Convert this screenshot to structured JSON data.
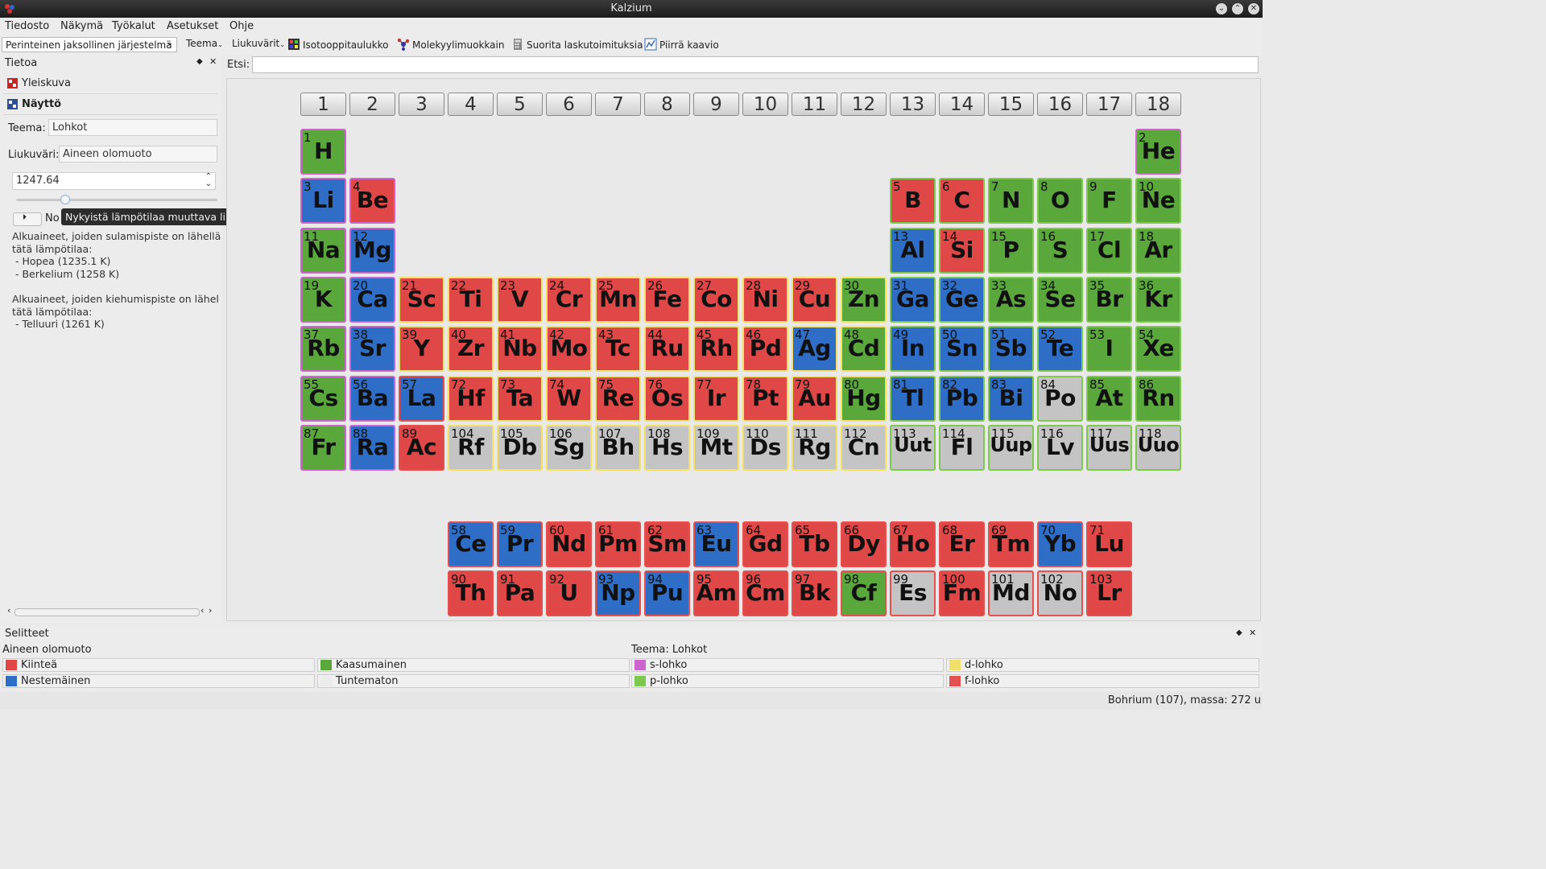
{
  "window": {
    "title": "Kalzium"
  },
  "menubar": {
    "items": [
      "Tiedosto",
      "Näkymä",
      "Työkalut",
      "Asetukset",
      "Ohje"
    ]
  },
  "toolbar": {
    "scheme_select": "Perinteinen jaksollinen järjestelmä",
    "theme_button": "Teema",
    "gradient_button": "Liukuvärit",
    "isotope_button": "Isotooppitaulukko",
    "molecule_button": "Molekyylimuokkain",
    "calculate_button": "Suorita laskutoimituksia",
    "plot_button": "Piirrä kaavio"
  },
  "sidepanel": {
    "title": "Tietoa",
    "tab_overview": "Yleiskuva",
    "tab_display": "Näyttö",
    "theme_label": "Teema:",
    "theme_value": "Lohkot",
    "gradient_label": "Liukuväri:",
    "gradient_value": "Aineen olomuoto",
    "temperature_value": "1247.64",
    "slider_fraction": 0.23,
    "play_label": "No",
    "tooltip": "Nykyistä lämpötilaa muuttava liukusäädin",
    "melting_text": "Alkuaineet, joiden sulamispiste on lähellä\ntätä lämpötilaa:\n - Hopea (1235.1 K)\n - Berkelium (1258 K)",
    "boiling_text": "Alkuaineet, joiden kiehumispiste on lähel\ntätä lämpötilaa:\n - Telluuri (1261 K)"
  },
  "search": {
    "label": "Etsi:",
    "value": ""
  },
  "groups": [
    "1",
    "2",
    "3",
    "4",
    "5",
    "6",
    "7",
    "8",
    "9",
    "10",
    "11",
    "12",
    "13",
    "14",
    "15",
    "16",
    "17",
    "18"
  ],
  "state_colors": {
    "solid": "#e04848",
    "liquid": "#2e6ec6",
    "gas": "#5aa83c",
    "unknown": "#c4c4c4"
  },
  "block_colors": {
    "s": "#cc66cc",
    "p": "#7ec850",
    "d": "#f2e06a",
    "f": "#e45050"
  },
  "elements": [
    {
      "n": 1,
      "s": "H",
      "g": 1,
      "p": 1,
      "st": "gas",
      "b": "s"
    },
    {
      "n": 2,
      "s": "He",
      "g": 18,
      "p": 1,
      "st": "gas",
      "b": "s"
    },
    {
      "n": 3,
      "s": "Li",
      "g": 1,
      "p": 2,
      "st": "liquid",
      "b": "s"
    },
    {
      "n": 4,
      "s": "Be",
      "g": 2,
      "p": 2,
      "st": "solid",
      "b": "s"
    },
    {
      "n": 5,
      "s": "B",
      "g": 13,
      "p": 2,
      "st": "solid",
      "b": "p"
    },
    {
      "n": 6,
      "s": "C",
      "g": 14,
      "p": 2,
      "st": "solid",
      "b": "p"
    },
    {
      "n": 7,
      "s": "N",
      "g": 15,
      "p": 2,
      "st": "gas",
      "b": "p"
    },
    {
      "n": 8,
      "s": "O",
      "g": 16,
      "p": 2,
      "st": "gas",
      "b": "p"
    },
    {
      "n": 9,
      "s": "F",
      "g": 17,
      "p": 2,
      "st": "gas",
      "b": "p"
    },
    {
      "n": 10,
      "s": "Ne",
      "g": 18,
      "p": 2,
      "st": "gas",
      "b": "p"
    },
    {
      "n": 11,
      "s": "Na",
      "g": 1,
      "p": 3,
      "st": "gas",
      "b": "s"
    },
    {
      "n": 12,
      "s": "Mg",
      "g": 2,
      "p": 3,
      "st": "liquid",
      "b": "s"
    },
    {
      "n": 13,
      "s": "Al",
      "g": 13,
      "p": 3,
      "st": "liquid",
      "b": "p"
    },
    {
      "n": 14,
      "s": "Si",
      "g": 14,
      "p": 3,
      "st": "solid",
      "b": "p"
    },
    {
      "n": 15,
      "s": "P",
      "g": 15,
      "p": 3,
      "st": "gas",
      "b": "p"
    },
    {
      "n": 16,
      "s": "S",
      "g": 16,
      "p": 3,
      "st": "gas",
      "b": "p"
    },
    {
      "n": 17,
      "s": "Cl",
      "g": 17,
      "p": 3,
      "st": "gas",
      "b": "p"
    },
    {
      "n": 18,
      "s": "Ar",
      "g": 18,
      "p": 3,
      "st": "gas",
      "b": "p"
    },
    {
      "n": 19,
      "s": "K",
      "g": 1,
      "p": 4,
      "st": "gas",
      "b": "s"
    },
    {
      "n": 20,
      "s": "Ca",
      "g": 2,
      "p": 4,
      "st": "liquid",
      "b": "s"
    },
    {
      "n": 21,
      "s": "Sc",
      "g": 3,
      "p": 4,
      "st": "solid",
      "b": "d"
    },
    {
      "n": 22,
      "s": "Ti",
      "g": 4,
      "p": 4,
      "st": "solid",
      "b": "d"
    },
    {
      "n": 23,
      "s": "V",
      "g": 5,
      "p": 4,
      "st": "solid",
      "b": "d"
    },
    {
      "n": 24,
      "s": "Cr",
      "g": 6,
      "p": 4,
      "st": "solid",
      "b": "d"
    },
    {
      "n": 25,
      "s": "Mn",
      "g": 7,
      "p": 4,
      "st": "solid",
      "b": "d"
    },
    {
      "n": 26,
      "s": "Fe",
      "g": 8,
      "p": 4,
      "st": "solid",
      "b": "d"
    },
    {
      "n": 27,
      "s": "Co",
      "g": 9,
      "p": 4,
      "st": "solid",
      "b": "d"
    },
    {
      "n": 28,
      "s": "Ni",
      "g": 10,
      "p": 4,
      "st": "solid",
      "b": "d"
    },
    {
      "n": 29,
      "s": "Cu",
      "g": 11,
      "p": 4,
      "st": "solid",
      "b": "d"
    },
    {
      "n": 30,
      "s": "Zn",
      "g": 12,
      "p": 4,
      "st": "gas",
      "b": "d"
    },
    {
      "n": 31,
      "s": "Ga",
      "g": 13,
      "p": 4,
      "st": "liquid",
      "b": "p"
    },
    {
      "n": 32,
      "s": "Ge",
      "g": 14,
      "p": 4,
      "st": "liquid",
      "b": "p"
    },
    {
      "n": 33,
      "s": "As",
      "g": 15,
      "p": 4,
      "st": "gas",
      "b": "p"
    },
    {
      "n": 34,
      "s": "Se",
      "g": 16,
      "p": 4,
      "st": "gas",
      "b": "p"
    },
    {
      "n": 35,
      "s": "Br",
      "g": 17,
      "p": 4,
      "st": "gas",
      "b": "p"
    },
    {
      "n": 36,
      "s": "Kr",
      "g": 18,
      "p": 4,
      "st": "gas",
      "b": "p"
    },
    {
      "n": 37,
      "s": "Rb",
      "g": 1,
      "p": 5,
      "st": "gas",
      "b": "s"
    },
    {
      "n": 38,
      "s": "Sr",
      "g": 2,
      "p": 5,
      "st": "liquid",
      "b": "s"
    },
    {
      "n": 39,
      "s": "Y",
      "g": 3,
      "p": 5,
      "st": "solid",
      "b": "d"
    },
    {
      "n": 40,
      "s": "Zr",
      "g": 4,
      "p": 5,
      "st": "solid",
      "b": "d"
    },
    {
      "n": 41,
      "s": "Nb",
      "g": 5,
      "p": 5,
      "st": "solid",
      "b": "d"
    },
    {
      "n": 42,
      "s": "Mo",
      "g": 6,
      "p": 5,
      "st": "solid",
      "b": "d"
    },
    {
      "n": 43,
      "s": "Tc",
      "g": 7,
      "p": 5,
      "st": "solid",
      "b": "d"
    },
    {
      "n": 44,
      "s": "Ru",
      "g": 8,
      "p": 5,
      "st": "solid",
      "b": "d"
    },
    {
      "n": 45,
      "s": "Rh",
      "g": 9,
      "p": 5,
      "st": "solid",
      "b": "d"
    },
    {
      "n": 46,
      "s": "Pd",
      "g": 10,
      "p": 5,
      "st": "solid",
      "b": "d"
    },
    {
      "n": 47,
      "s": "Ag",
      "g": 11,
      "p": 5,
      "st": "liquid",
      "b": "d"
    },
    {
      "n": 48,
      "s": "Cd",
      "g": 12,
      "p": 5,
      "st": "gas",
      "b": "d"
    },
    {
      "n": 49,
      "s": "In",
      "g": 13,
      "p": 5,
      "st": "liquid",
      "b": "p"
    },
    {
      "n": 50,
      "s": "Sn",
      "g": 14,
      "p": 5,
      "st": "liquid",
      "b": "p"
    },
    {
      "n": 51,
      "s": "Sb",
      "g": 15,
      "p": 5,
      "st": "liquid",
      "b": "p"
    },
    {
      "n": 52,
      "s": "Te",
      "g": 16,
      "p": 5,
      "st": "liquid",
      "b": "p"
    },
    {
      "n": 53,
      "s": "I",
      "g": 17,
      "p": 5,
      "st": "gas",
      "b": "p"
    },
    {
      "n": 54,
      "s": "Xe",
      "g": 18,
      "p": 5,
      "st": "gas",
      "b": "p"
    },
    {
      "n": 55,
      "s": "Cs",
      "g": 1,
      "p": 6,
      "st": "gas",
      "b": "s"
    },
    {
      "n": 56,
      "s": "Ba",
      "g": 2,
      "p": 6,
      "st": "liquid",
      "b": "s"
    },
    {
      "n": 57,
      "s": "La",
      "g": 3,
      "p": 6,
      "st": "liquid",
      "b": "f"
    },
    {
      "n": 72,
      "s": "Hf",
      "g": 4,
      "p": 6,
      "st": "solid",
      "b": "d"
    },
    {
      "n": 73,
      "s": "Ta",
      "g": 5,
      "p": 6,
      "st": "solid",
      "b": "d"
    },
    {
      "n": 74,
      "s": "W",
      "g": 6,
      "p": 6,
      "st": "solid",
      "b": "d"
    },
    {
      "n": 75,
      "s": "Re",
      "g": 7,
      "p": 6,
      "st": "solid",
      "b": "d"
    },
    {
      "n": 76,
      "s": "Os",
      "g": 8,
      "p": 6,
      "st": "solid",
      "b": "d"
    },
    {
      "n": 77,
      "s": "Ir",
      "g": 9,
      "p": 6,
      "st": "solid",
      "b": "d"
    },
    {
      "n": 78,
      "s": "Pt",
      "g": 10,
      "p": 6,
      "st": "solid",
      "b": "d"
    },
    {
      "n": 79,
      "s": "Au",
      "g": 11,
      "p": 6,
      "st": "solid",
      "b": "d"
    },
    {
      "n": 80,
      "s": "Hg",
      "g": 12,
      "p": 6,
      "st": "gas",
      "b": "d"
    },
    {
      "n": 81,
      "s": "Tl",
      "g": 13,
      "p": 6,
      "st": "liquid",
      "b": "p"
    },
    {
      "n": 82,
      "s": "Pb",
      "g": 14,
      "p": 6,
      "st": "liquid",
      "b": "p"
    },
    {
      "n": 83,
      "s": "Bi",
      "g": 15,
      "p": 6,
      "st": "liquid",
      "b": "p"
    },
    {
      "n": 84,
      "s": "Po",
      "g": 16,
      "p": 6,
      "st": "unknown",
      "b": "p"
    },
    {
      "n": 85,
      "s": "At",
      "g": 17,
      "p": 6,
      "st": "gas",
      "b": "p"
    },
    {
      "n": 86,
      "s": "Rn",
      "g": 18,
      "p": 6,
      "st": "gas",
      "b": "p"
    },
    {
      "n": 87,
      "s": "Fr",
      "g": 1,
      "p": 7,
      "st": "gas",
      "b": "s"
    },
    {
      "n": 88,
      "s": "Ra",
      "g": 2,
      "p": 7,
      "st": "liquid",
      "b": "s"
    },
    {
      "n": 89,
      "s": "Ac",
      "g": 3,
      "p": 7,
      "st": "solid",
      "b": "f"
    },
    {
      "n": 104,
      "s": "Rf",
      "g": 4,
      "p": 7,
      "st": "unknown",
      "b": "d"
    },
    {
      "n": 105,
      "s": "Db",
      "g": 5,
      "p": 7,
      "st": "unknown",
      "b": "d"
    },
    {
      "n": 106,
      "s": "Sg",
      "g": 6,
      "p": 7,
      "st": "unknown",
      "b": "d"
    },
    {
      "n": 107,
      "s": "Bh",
      "g": 7,
      "p": 7,
      "st": "unknown",
      "b": "d"
    },
    {
      "n": 108,
      "s": "Hs",
      "g": 8,
      "p": 7,
      "st": "unknown",
      "b": "d"
    },
    {
      "n": 109,
      "s": "Mt",
      "g": 9,
      "p": 7,
      "st": "unknown",
      "b": "d"
    },
    {
      "n": 110,
      "s": "Ds",
      "g": 10,
      "p": 7,
      "st": "unknown",
      "b": "d"
    },
    {
      "n": 111,
      "s": "Rg",
      "g": 11,
      "p": 7,
      "st": "unknown",
      "b": "d"
    },
    {
      "n": 112,
      "s": "Cn",
      "g": 12,
      "p": 7,
      "st": "unknown",
      "b": "d"
    },
    {
      "n": 113,
      "s": "Uut",
      "g": 13,
      "p": 7,
      "st": "unknown",
      "b": "p"
    },
    {
      "n": 114,
      "s": "Fl",
      "g": 14,
      "p": 7,
      "st": "unknown",
      "b": "p"
    },
    {
      "n": 115,
      "s": "Uup",
      "g": 15,
      "p": 7,
      "st": "unknown",
      "b": "p"
    },
    {
      "n": 116,
      "s": "Lv",
      "g": 16,
      "p": 7,
      "st": "unknown",
      "b": "p"
    },
    {
      "n": 117,
      "s": "Uus",
      "g": 17,
      "p": 7,
      "st": "unknown",
      "b": "p"
    },
    {
      "n": 118,
      "s": "Uuo",
      "g": 18,
      "p": 7,
      "st": "unknown",
      "b": "p"
    },
    {
      "n": 58,
      "s": "Ce",
      "g": 4,
      "p": 9,
      "st": "liquid",
      "b": "f"
    },
    {
      "n": 59,
      "s": "Pr",
      "g": 5,
      "p": 9,
      "st": "liquid",
      "b": "f"
    },
    {
      "n": 60,
      "s": "Nd",
      "g": 6,
      "p": 9,
      "st": "solid",
      "b": "f"
    },
    {
      "n": 61,
      "s": "Pm",
      "g": 7,
      "p": 9,
      "st": "solid",
      "b": "f"
    },
    {
      "n": 62,
      "s": "Sm",
      "g": 8,
      "p": 9,
      "st": "solid",
      "b": "f"
    },
    {
      "n": 63,
      "s": "Eu",
      "g": 9,
      "p": 9,
      "st": "liquid",
      "b": "f"
    },
    {
      "n": 64,
      "s": "Gd",
      "g": 10,
      "p": 9,
      "st": "solid",
      "b": "f"
    },
    {
      "n": 65,
      "s": "Tb",
      "g": 11,
      "p": 9,
      "st": "solid",
      "b": "f"
    },
    {
      "n": 66,
      "s": "Dy",
      "g": 12,
      "p": 9,
      "st": "solid",
      "b": "f"
    },
    {
      "n": 67,
      "s": "Ho",
      "g": 13,
      "p": 9,
      "st": "solid",
      "b": "f"
    },
    {
      "n": 68,
      "s": "Er",
      "g": 14,
      "p": 9,
      "st": "solid",
      "b": "f"
    },
    {
      "n": 69,
      "s": "Tm",
      "g": 15,
      "p": 9,
      "st": "solid",
      "b": "f"
    },
    {
      "n": 70,
      "s": "Yb",
      "g": 16,
      "p": 9,
      "st": "liquid",
      "b": "f"
    },
    {
      "n": 71,
      "s": "Lu",
      "g": 17,
      "p": 9,
      "st": "solid",
      "b": "f"
    },
    {
      "n": 90,
      "s": "Th",
      "g": 4,
      "p": 10,
      "st": "solid",
      "b": "f"
    },
    {
      "n": 91,
      "s": "Pa",
      "g": 5,
      "p": 10,
      "st": "solid",
      "b": "f"
    },
    {
      "n": 92,
      "s": "U",
      "g": 6,
      "p": 10,
      "st": "solid",
      "b": "f"
    },
    {
      "n": 93,
      "s": "Np",
      "g": 7,
      "p": 10,
      "st": "liquid",
      "b": "f"
    },
    {
      "n": 94,
      "s": "Pu",
      "g": 8,
      "p": 10,
      "st": "liquid",
      "b": "f"
    },
    {
      "n": 95,
      "s": "Am",
      "g": 9,
      "p": 10,
      "st": "solid",
      "b": "f"
    },
    {
      "n": 96,
      "s": "Cm",
      "g": 10,
      "p": 10,
      "st": "solid",
      "b": "f"
    },
    {
      "n": 97,
      "s": "Bk",
      "g": 11,
      "p": 10,
      "st": "solid",
      "b": "f"
    },
    {
      "n": 98,
      "s": "Cf",
      "g": 12,
      "p": 10,
      "st": "gas",
      "b": "f"
    },
    {
      "n": 99,
      "s": "Es",
      "g": 13,
      "p": 10,
      "st": "unknown",
      "b": "f"
    },
    {
      "n": 100,
      "s": "Fm",
      "g": 14,
      "p": 10,
      "st": "solid",
      "b": "f"
    },
    {
      "n": 101,
      "s": "Md",
      "g": 15,
      "p": 10,
      "st": "unknown",
      "b": "f"
    },
    {
      "n": 102,
      "s": "No",
      "g": 16,
      "p": 10,
      "st": "unknown",
      "b": "f"
    },
    {
      "n": 103,
      "s": "Lr",
      "g": 17,
      "p": 10,
      "st": "solid",
      "b": "f"
    }
  ],
  "legend": {
    "title": "Selitteet",
    "gradient_title": "Aineen olomuoto",
    "theme_title": "Teema: Lohkot",
    "solid": "Kiinteä",
    "gas": "Kaasumainen",
    "liquid": "Nestemäinen",
    "unknown": "Tuntematon",
    "s_block": "s-lohko",
    "p_block": "p-lohko",
    "d_block": "d-lohko",
    "f_block": "f-lohko"
  },
  "statusbar": {
    "text": "Bohrium (107), massa: 272 u"
  }
}
